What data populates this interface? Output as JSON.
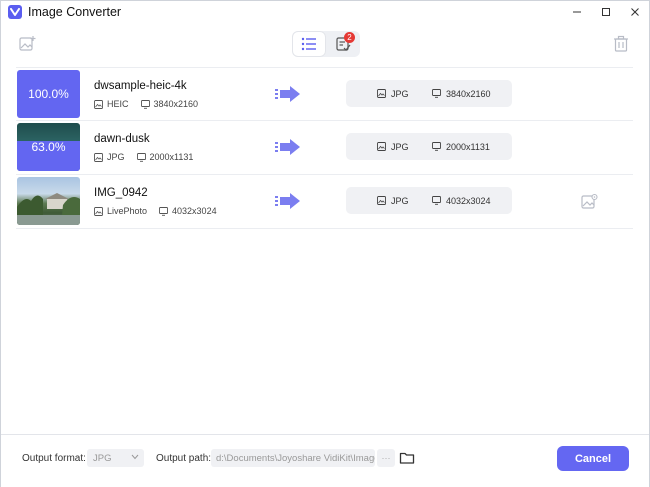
{
  "window": {
    "title": "Image Converter",
    "minimize_icon": "minimize-icon",
    "maximize_icon": "maximize-icon",
    "close_icon": "close-icon"
  },
  "toolbar": {
    "add_icon": "add-image-icon",
    "list_icon": "list-view-icon",
    "tasks_icon": "task-list-icon",
    "tasks_badge": "2",
    "trash_icon": "trash-icon"
  },
  "colors": {
    "accent": "#6467f2",
    "progress": "#6366f1",
    "arrow": "#7b7ef0",
    "badge": "#e53935"
  },
  "files": [
    {
      "name": "dwsample-heic-4k",
      "format": "HEIC",
      "resolution": "3840x2160",
      "progress_label": "100.0%",
      "progress": 1.0,
      "output_format": "JPG",
      "output_resolution": "3840x2160"
    },
    {
      "name": "dawn-dusk",
      "format": "JPG",
      "resolution": "2000x1131",
      "progress_label": "63.0%",
      "progress": 0.63,
      "output_format": "JPG",
      "output_resolution": "2000x1131"
    },
    {
      "name": "IMG_0942",
      "format": "LivePhoto",
      "resolution": "4032x3024",
      "progress_label": "",
      "progress": 0,
      "output_format": "JPG",
      "output_resolution": "4032x3024"
    }
  ],
  "footer": {
    "output_format_label": "Output format:",
    "output_format_value": "JPG",
    "output_path_label": "Output path:",
    "output_path_value": "d:\\Documents\\Joyoshare VidiKit\\Image",
    "more_label": "···",
    "cancel_label": "Cancel"
  }
}
